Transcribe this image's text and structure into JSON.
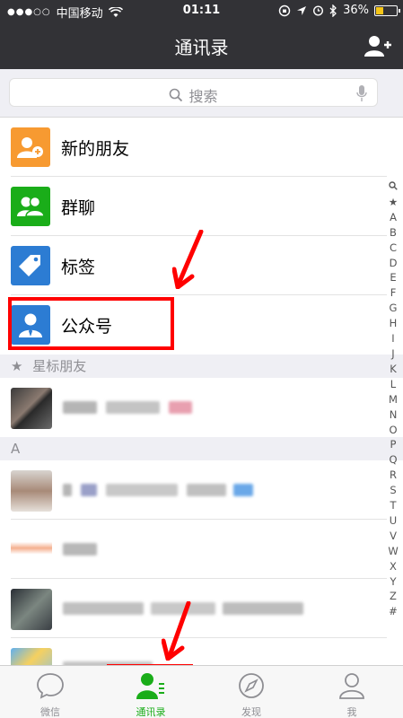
{
  "status_bar": {
    "carrier": "中国移动",
    "time": "01:11",
    "battery": "36%",
    "battery_level": 0.36
  },
  "nav": {
    "title": "通讯录",
    "add_icon": "add-friend-icon"
  },
  "search": {
    "placeholder": "搜索"
  },
  "functions": [
    {
      "label": "新的朋友",
      "icon": "new-friend-icon",
      "color": "#f79a31"
    },
    {
      "label": "群聊",
      "icon": "group-chat-icon",
      "color": "#1aad19"
    },
    {
      "label": "标签",
      "icon": "tag-icon",
      "color": "#2c7cd3"
    },
    {
      "label": "公众号",
      "icon": "official-account-icon",
      "color": "#2c7cd3"
    }
  ],
  "sections": {
    "starred": "星标朋友",
    "a": "A"
  },
  "index": [
    "★",
    "A",
    "B",
    "C",
    "D",
    "E",
    "F",
    "G",
    "H",
    "I",
    "J",
    "K",
    "L",
    "M",
    "N",
    "O",
    "P",
    "Q",
    "R",
    "S",
    "T",
    "U",
    "V",
    "W",
    "X",
    "Y",
    "Z",
    "#"
  ],
  "tabs": [
    {
      "label": "微信",
      "icon": "chat-bubble-icon"
    },
    {
      "label": "通讯录",
      "icon": "contacts-icon",
      "active": true
    },
    {
      "label": "发现",
      "icon": "compass-icon"
    },
    {
      "label": "我",
      "icon": "person-icon"
    }
  ],
  "colors": {
    "nav_bg": "#323236",
    "accent_green": "#1aad19",
    "annotation_red": "#ff0000"
  }
}
